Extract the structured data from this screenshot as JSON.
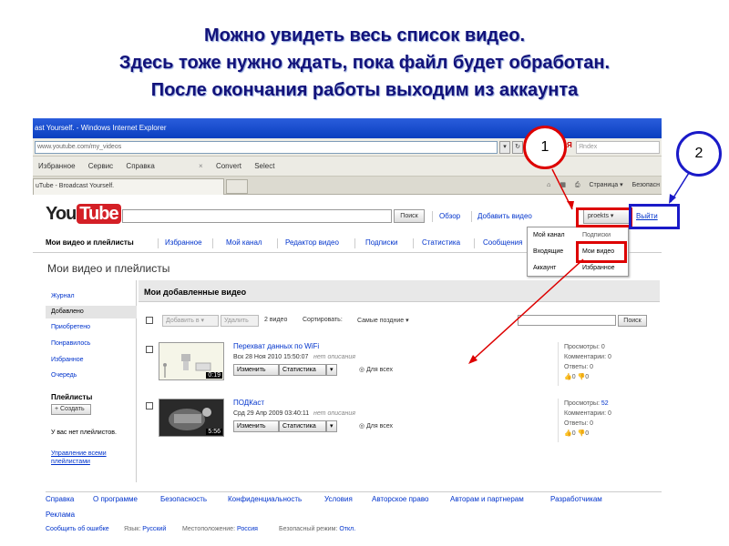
{
  "slide": {
    "line1": "Можно увидеть весь список видео.",
    "line2": "Здесь тоже нужно ждать, пока файл будет обработан.",
    "line3": "После окончания работы выходим из аккаунта",
    "callout1": "1",
    "callout2": "2"
  },
  "browser": {
    "window_title": "ast Yourself. - Windows Internet Explorer",
    "url": "www.youtube.com/my_videos",
    "yandex_label": "Я",
    "yandex_placeholder": "Яndex",
    "menu": [
      "Избранное",
      "Сервис",
      "Справка"
    ],
    "toolbar_close": "×",
    "convert_label": "Convert",
    "select_label": "Select",
    "tab_label": "uTube - Broadcast Yourself.",
    "tools": [
      "Страница ▾",
      "Безопасн"
    ]
  },
  "youtube": {
    "logo_you": "You",
    "logo_tube": "Tube",
    "search_button": "Поиск",
    "header_links": [
      "Обзор",
      "Добавить видео"
    ],
    "account_button": "proekts",
    "logout": "Выйти",
    "nav": [
      "Мои видео и плейлисты",
      "Избранное",
      "Мой канал",
      "Редактор видео",
      "Подписки",
      "Статистика",
      "Сообщения"
    ],
    "dropdown": {
      "col1": [
        "Мой канал",
        "Входящие",
        "Аккаунт"
      ],
      "col2": [
        "Подписки",
        "Мои видео",
        "Избранное"
      ]
    },
    "page_heading": "Мои видео и плейлисты",
    "sidebar": {
      "items": [
        "Журнал",
        "Добавлено",
        "Приобретено",
        "Понравилось",
        "Избранное",
        "Очередь"
      ],
      "playlists_heading": "Плейлисты",
      "create_button": "+ Создать",
      "no_playlists": "У вас нет плейлистов.",
      "manage_link": "Управление всеми плейлистами"
    },
    "main": {
      "title": "Мои добавленные видео",
      "add_to": "Добавить в ▾",
      "delete": "Удалить",
      "count": "2 видео",
      "sort_label": "Сортировать:",
      "sort_value": "Самые поздние",
      "search_button": "Поиск"
    },
    "videos": [
      {
        "title": "Перехват данных по WiFi",
        "date": "Вск 28 Ноя 2010 15:50:07",
        "desc": "нет описания",
        "duration": "0:19",
        "edit": "Изменить",
        "stats": "Статистика",
        "privacy": "Для всех",
        "views": "Просмотры: 0",
        "comments": "Комментарии: 0",
        "replies": "Ответы: 0",
        "likes": "0",
        "dislikes": "0"
      },
      {
        "title": "ПОДКаст",
        "date": "Срд 29 Апр 2009 03:40:11",
        "desc": "нет описания",
        "duration": "5:56",
        "edit": "Изменить",
        "stats": "Статистика",
        "privacy": "Для всех",
        "views_label": "Просмотры:",
        "views_value": "52",
        "comments": "Комментарии: 0",
        "replies": "Ответы: 0",
        "likes": "0",
        "dislikes": "0"
      }
    ],
    "footer": {
      "links": [
        "Справка",
        "О программе",
        "Безопасность",
        "Конфиденциальность",
        "Условия",
        "Авторское право",
        "Авторам и партнерам",
        "Разработчикам",
        "Реклама"
      ],
      "report": "Сообщить об ошибке",
      "lang_label": "Язык:",
      "lang_value": "Русский",
      "loc_label": "Местоположение:",
      "loc_value": "Россия",
      "safe_label": "Безопасный режим:",
      "safe_value": "Откл."
    }
  },
  "colors": {
    "title_text": "#12127a",
    "annotation_red": "#dd0000",
    "annotation_blue": "#1a1ac8",
    "link": "#0033cc"
  }
}
